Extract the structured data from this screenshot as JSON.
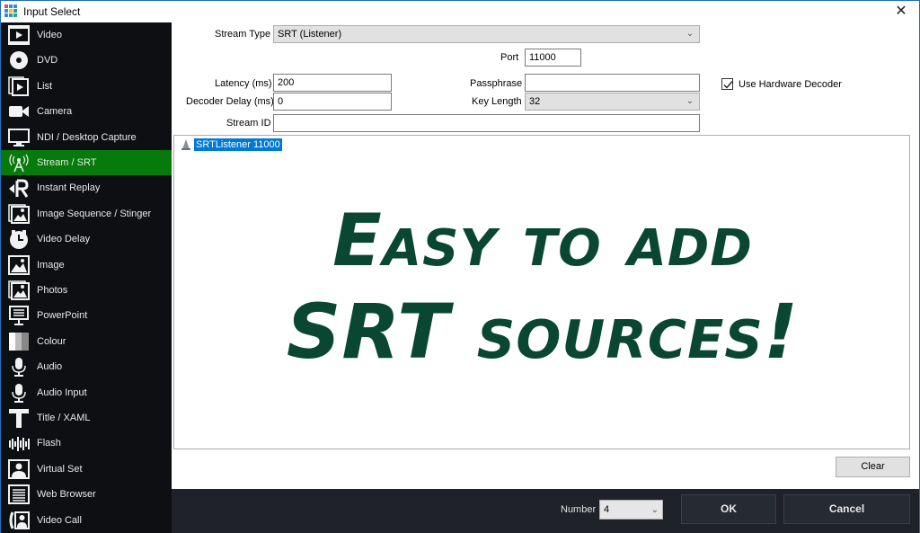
{
  "window": {
    "title": "Input Select",
    "close_glyph": "✕",
    "accent_color": "#1f6fb5"
  },
  "sidebar": {
    "active_color": "#067b0b",
    "items": [
      {
        "label": "Video",
        "icon": "video-icon"
      },
      {
        "label": "DVD",
        "icon": "dvd-icon"
      },
      {
        "label": "List",
        "icon": "list-icon"
      },
      {
        "label": "Camera",
        "icon": "camera-icon"
      },
      {
        "label": "NDI / Desktop Capture",
        "icon": "monitor-icon"
      },
      {
        "label": "Stream / SRT",
        "icon": "antenna-icon",
        "active": true
      },
      {
        "label": "Instant Replay",
        "icon": "replay-icon"
      },
      {
        "label": "Image Sequence / Stinger",
        "icon": "image-sequence-icon"
      },
      {
        "label": "Video Delay",
        "icon": "clock-icon"
      },
      {
        "label": "Image",
        "icon": "image-icon"
      },
      {
        "label": "Photos",
        "icon": "photos-icon"
      },
      {
        "label": "PowerPoint",
        "icon": "presentation-icon"
      },
      {
        "label": "Colour",
        "icon": "colour-icon"
      },
      {
        "label": "Audio",
        "icon": "microphone-icon"
      },
      {
        "label": "Audio Input",
        "icon": "audio-input-icon"
      },
      {
        "label": "Title / XAML",
        "icon": "title-icon"
      },
      {
        "label": "Flash",
        "icon": "flash-icon"
      },
      {
        "label": "Virtual Set",
        "icon": "virtual-set-icon"
      },
      {
        "label": "Web Browser",
        "icon": "web-browser-icon"
      },
      {
        "label": "Video Call",
        "icon": "video-call-icon"
      }
    ]
  },
  "form": {
    "stream_type": {
      "label": "Stream Type",
      "value": "SRT (Listener)"
    },
    "port": {
      "label": "Port",
      "value": "11000"
    },
    "latency": {
      "label": "Latency (ms)",
      "value": "200"
    },
    "decoder_delay": {
      "label": "Decoder Delay (ms)",
      "value": "0"
    },
    "stream_id": {
      "label": "Stream ID",
      "value": ""
    },
    "passphrase": {
      "label": "Passphrase",
      "value": ""
    },
    "key_length": {
      "label": "Key Length",
      "value": "32"
    },
    "hardware_decoder": {
      "label": "Use Hardware Decoder",
      "checked": true
    }
  },
  "preview": {
    "list_items": [
      {
        "label": "SRTListener  11000",
        "selected": true,
        "icon": "vlc-cone-icon"
      }
    ],
    "overlay_line1": "Easy to add",
    "overlay_line2": "SRT sources!",
    "overlay_color": "#094733"
  },
  "actions": {
    "clear_label": "Clear",
    "number_label": "Number",
    "number_value": "4",
    "ok_label": "OK",
    "cancel_label": "Cancel"
  }
}
